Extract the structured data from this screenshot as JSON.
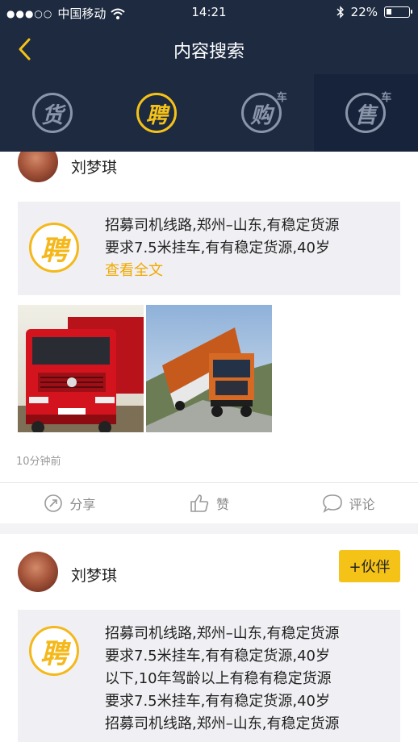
{
  "status_bar": {
    "carrier": "中国移动",
    "time": "14:21",
    "battery": "22%"
  },
  "nav": {
    "title": "内容搜索"
  },
  "tabs": [
    {
      "label": "货",
      "badge": ""
    },
    {
      "label": "聘",
      "badge": ""
    },
    {
      "label": "购",
      "badge": "车"
    },
    {
      "label": "售",
      "badge": "车"
    }
  ],
  "posts": [
    {
      "author": "刘梦琪",
      "badge": "聘",
      "lines": [
        "招募司机线路,郑州–山东,有稳定货源",
        "要求7.5米挂车,有有稳定货源,40岁"
      ],
      "read_more": "查看全文",
      "time_ago": "10分钟前",
      "actions": {
        "share": "分享",
        "like": "赞",
        "comment": "评论"
      }
    },
    {
      "author": "刘梦琪",
      "partner_button": "+伙伴",
      "badge": "聘",
      "lines": [
        "招募司机线路,郑州–山东,有稳定货源",
        "要求7.5米挂车,有有稳定货源,40岁",
        "以下,10年驾龄以上有稳有稳定货源",
        "要求7.5米挂车,有有稳定货源,40岁",
        "招募司机线路,郑州–山东,有稳定货源"
      ]
    }
  ],
  "colors": {
    "header_bg": "#1d2a40",
    "accent": "#f5c218",
    "tab_inactive": "#8a95aa"
  }
}
